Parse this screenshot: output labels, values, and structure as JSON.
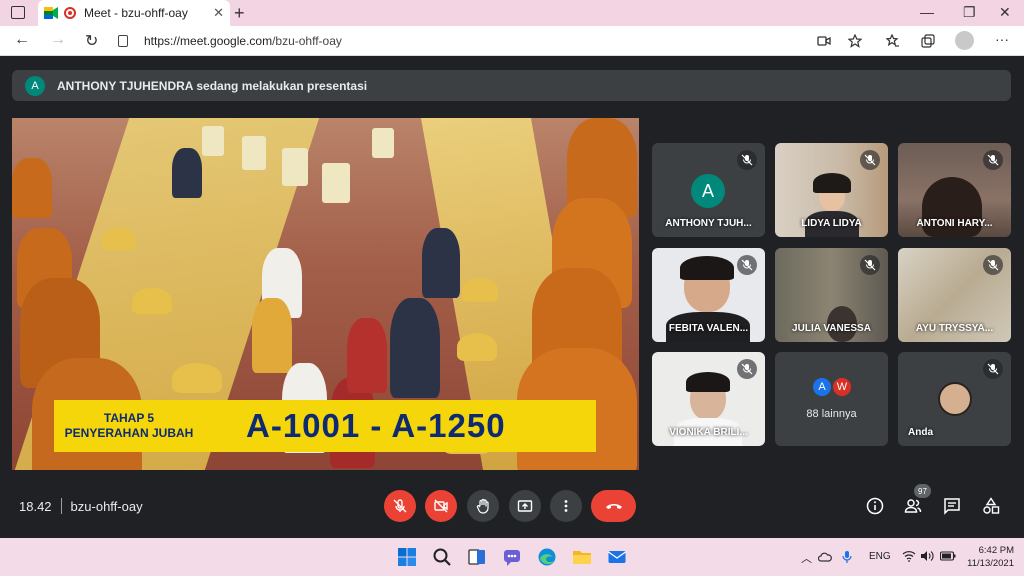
{
  "browser": {
    "tab_title": "Meet - bzu-ohff-oay",
    "url_host": "https://meet.google.com",
    "url_path": "/bzu-ohff-oay"
  },
  "meet": {
    "presenting_initial": "A",
    "presenting_text": "ANTHONY TJUHENDRA sedang melakukan presentasi",
    "presentation": {
      "caption_line1": "TAHAP 5",
      "caption_line2": "PENYERAHAN JUBAH",
      "caption_big": "A-1001 - A-1250"
    },
    "participants": [
      {
        "name": "ANTHONY TJUH...",
        "initial": "A"
      },
      {
        "name": "LIDYA LIDYA"
      },
      {
        "name": "ANTONI HARY..."
      },
      {
        "name": "FEBITA VALEN..."
      },
      {
        "name": "JULIA VANESSA"
      },
      {
        "name": "AYU TRYSSYA..."
      },
      {
        "name": "VIONIKA BRILI..."
      },
      {
        "name": "88 lainnya",
        "avatars": [
          "A",
          "W"
        ]
      },
      {
        "name": "Anda"
      }
    ],
    "time": "18.42",
    "meeting_code": "bzu-ohff-oay",
    "people_count": "97"
  },
  "taskbar": {
    "language": "ENG",
    "time": "6:42 PM",
    "date": "11/13/2021"
  },
  "colors": {
    "accent_red": "#ea4335",
    "meet_bg": "#202124",
    "tile_bg": "#3c4043",
    "avatar_teal": "#00897b",
    "caption_yellow": "#f4d60a",
    "caption_blue": "#0d2a73"
  }
}
